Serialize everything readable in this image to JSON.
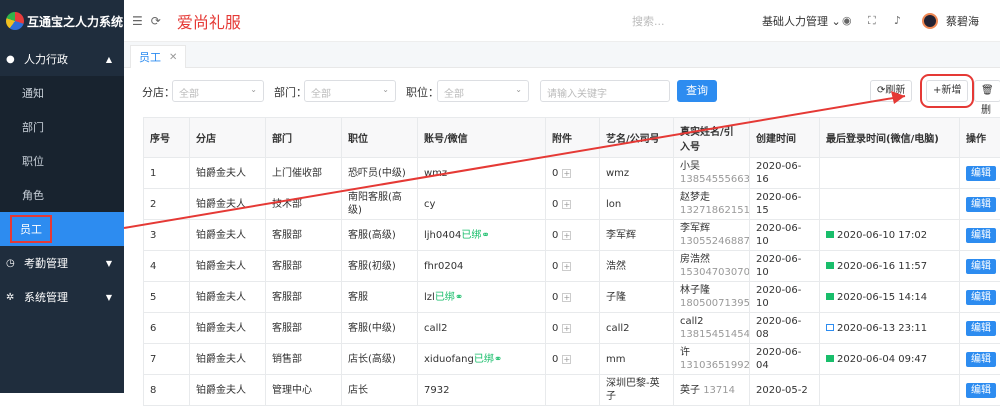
{
  "sidebar": {
    "app_name": "互通宝之人力系统",
    "groups": [
      {
        "label": "人力行政",
        "icon": "users-icon",
        "expanded": true
      },
      {
        "label": "考勤管理",
        "icon": "clock-icon"
      },
      {
        "label": "系统管理",
        "icon": "gear-icon"
      }
    ],
    "items": [
      {
        "label": "通知"
      },
      {
        "label": "部门"
      },
      {
        "label": "职位"
      },
      {
        "label": "角色"
      },
      {
        "label": "员工",
        "active": true
      }
    ]
  },
  "header": {
    "company_brand": "爱尚礼服",
    "search_placeholder": "搜索...",
    "company_select": "基础人力管理",
    "user_name": "蔡碧海"
  },
  "tabs": [
    {
      "label": "员工"
    }
  ],
  "filters": {
    "store_label": "分店：",
    "store_value": "全部",
    "dept_label": "部门：",
    "dept_value": "全部",
    "pos_label": "职位：",
    "pos_value": "全部",
    "keyword_placeholder": "请输入关键字",
    "query": "查询"
  },
  "toolbar": {
    "refresh": "刷新",
    "add": "新增",
    "delete": "删"
  },
  "table": {
    "headers": [
      "序号",
      "分店",
      "部门",
      "职位",
      "账号/微信",
      "附件",
      "艺名/公司号",
      "真实姓名/引入号",
      "创建时间",
      "最后登录时间(微信/电脑)",
      "操作"
    ],
    "rows": [
      {
        "no": "1",
        "store": "铂爵金夫人",
        "dept": "上门催收部",
        "pos": "恐吓员(中级)",
        "acct": "wmz",
        "bound": "",
        "att": "0",
        "stage": "wmz",
        "real": "小吴",
        "phone": "13854555663",
        "created": "2020-06-16",
        "login": "",
        "login_type": ""
      },
      {
        "no": "2",
        "store": "铂爵金夫人",
        "dept": "技术部",
        "pos": "南阳客服(高级)",
        "acct": "cy",
        "bound": "",
        "att": "0",
        "stage": "lon",
        "real": "赵梦走",
        "phone": "13271862151",
        "created": "2020-06-15",
        "login": "",
        "login_type": ""
      },
      {
        "no": "3",
        "store": "铂爵金夫人",
        "dept": "客服部",
        "pos": "客服(高级)",
        "acct": "ljh0404",
        "bound": "已绑",
        "att": "0",
        "stage": "李军辉",
        "real": "李军辉",
        "phone": "13055246887",
        "created": "2020-06-10",
        "login": "2020-06-10 17:02",
        "login_type": "wechat"
      },
      {
        "no": "4",
        "store": "铂爵金夫人",
        "dept": "客服部",
        "pos": "客服(初级)",
        "acct": "fhr0204",
        "bound": "",
        "att": "0",
        "stage": "浩然",
        "real": "房浩然",
        "phone": "15304703070",
        "created": "2020-06-10",
        "login": "2020-06-16 11:57",
        "login_type": "wechat"
      },
      {
        "no": "5",
        "store": "铂爵金夫人",
        "dept": "客服部",
        "pos": "客服",
        "acct": "lzl",
        "bound": "已绑",
        "att": "0",
        "stage": "子隆",
        "real": "林子隆",
        "phone": "18050071395",
        "created": "2020-06-10",
        "login": "2020-06-15 14:14",
        "login_type": "wechat"
      },
      {
        "no": "6",
        "store": "铂爵金夫人",
        "dept": "客服部",
        "pos": "客服(中级)",
        "acct": "call2",
        "bound": "",
        "att": "0",
        "stage": "call2",
        "real": "call2",
        "phone": "13815451454",
        "created": "2020-06-08",
        "login": "2020-06-13 23:11",
        "login_type": "pc"
      },
      {
        "no": "7",
        "store": "铂爵金夫人",
        "dept": "销售部",
        "pos": "店长(高级)",
        "acct": "xiduofang",
        "bound": "已绑",
        "att": "0",
        "stage": "mm",
        "real": "许",
        "phone": "13103651992",
        "created": "2020-06-04",
        "login": "2020-06-04 09:47",
        "login_type": "wechat"
      },
      {
        "no": "8",
        "store": "铂爵金夫人",
        "dept": "管理中心",
        "pos": "店长",
        "acct": "7932",
        "bound": "",
        "att": "",
        "stage": "深圳巴黎-英子",
        "real": "英子",
        "phone": "13714",
        "created": "2020-05-2",
        "login": "",
        "login_type": ""
      }
    ],
    "edit_label": "编辑"
  },
  "colors": {
    "primary": "#2d8cf0",
    "sidebar_bg": "#1f2d3d",
    "brand_red": "#e53935",
    "annotation_red": "#e53935"
  }
}
